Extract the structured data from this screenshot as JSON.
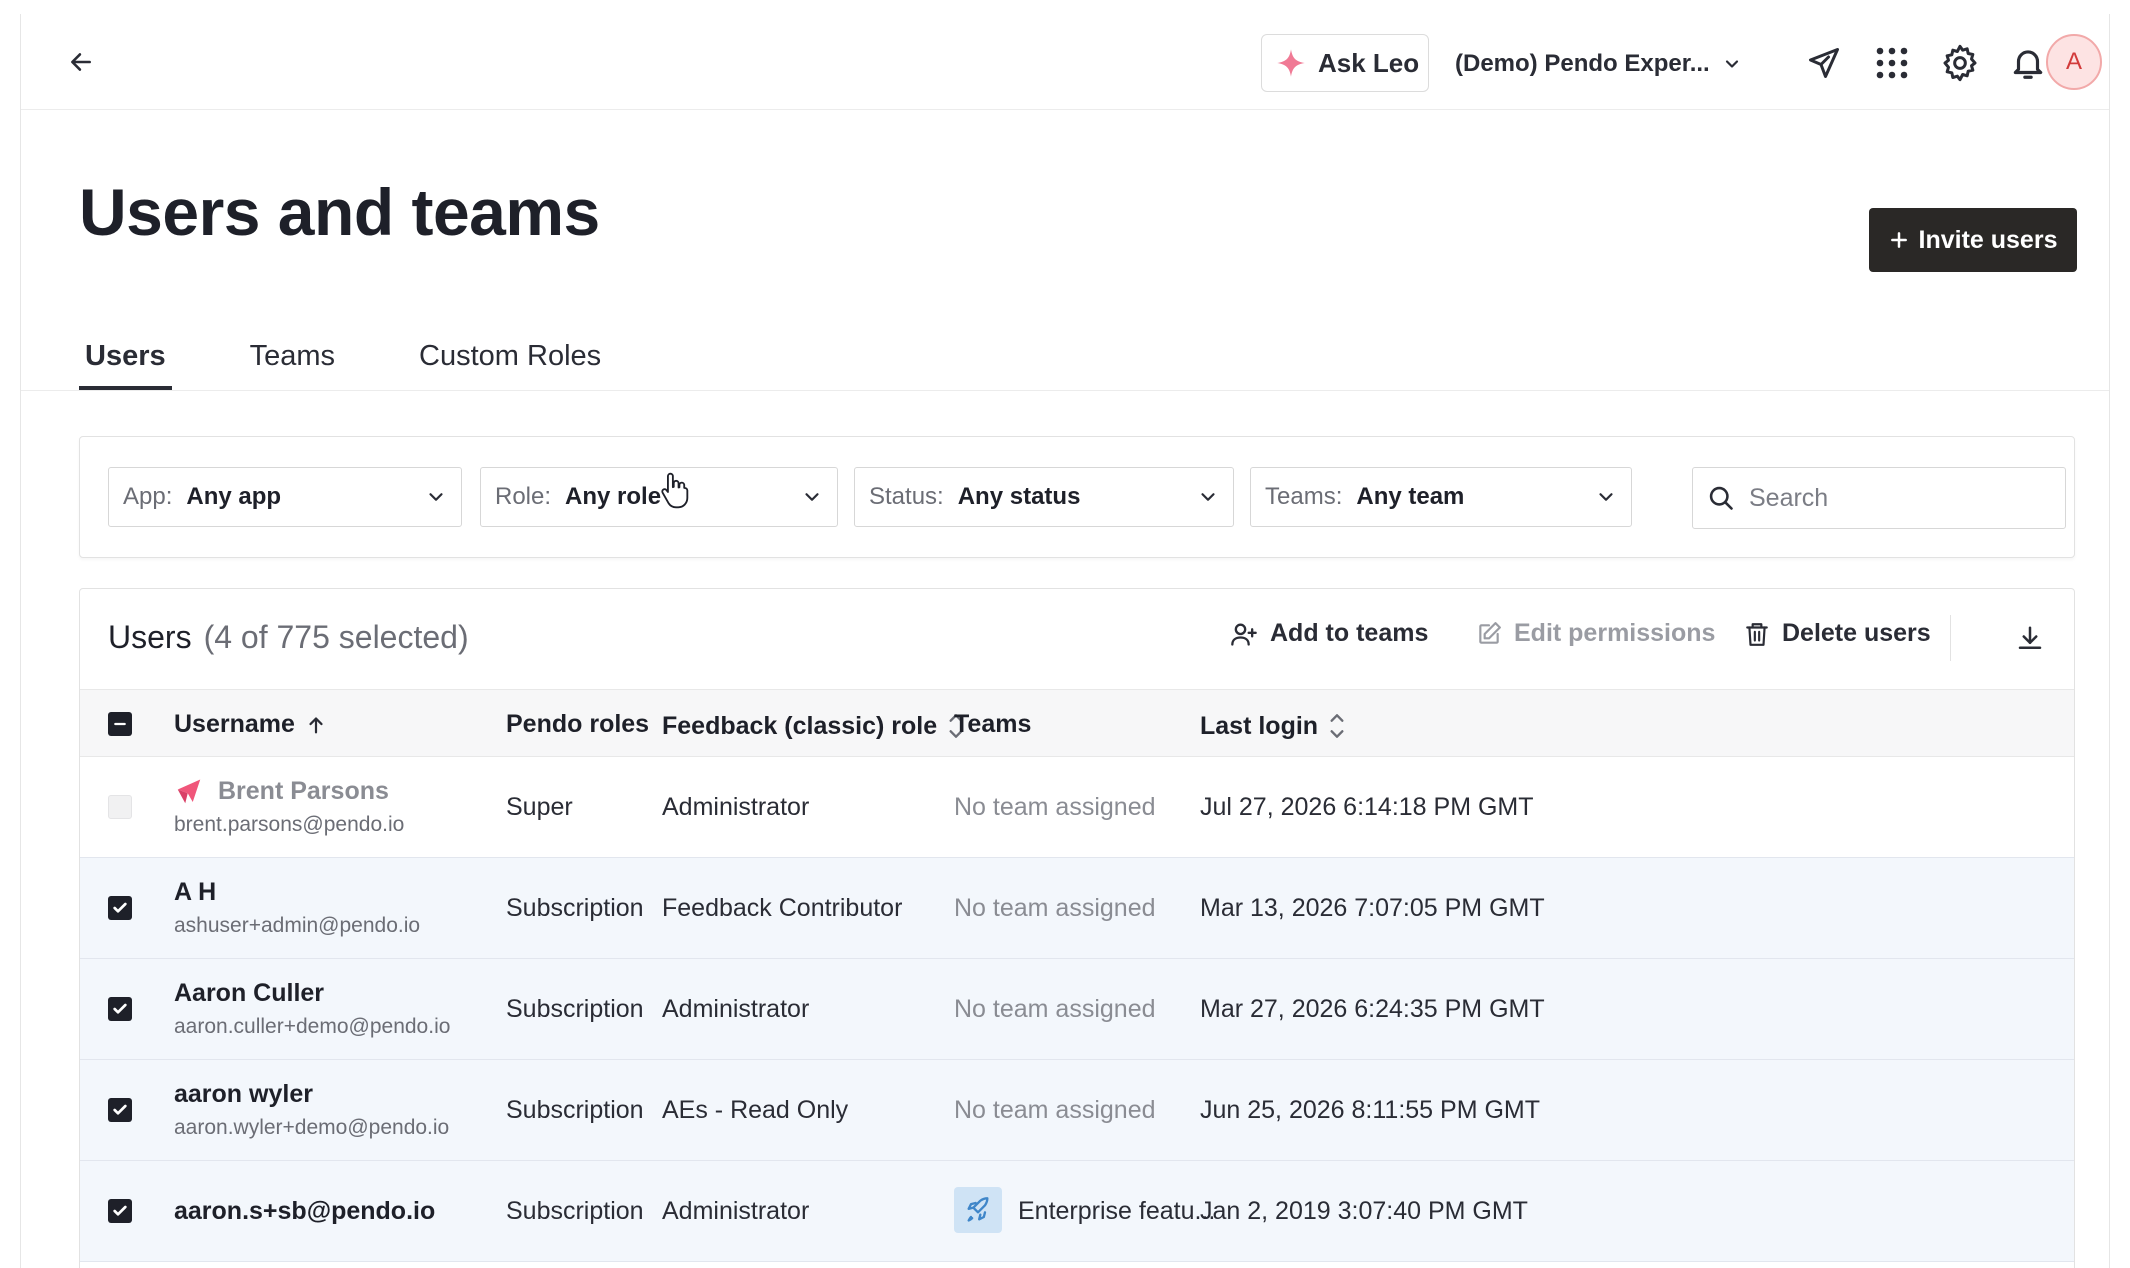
{
  "topbar": {
    "ask_leo": "Ask Leo",
    "app_name": "(Demo) Pendo Exper...",
    "avatar_initial": "A"
  },
  "page": {
    "title": "Users and teams",
    "invite_label": "Invite users"
  },
  "tabs": [
    {
      "label": "Users",
      "active": true
    },
    {
      "label": "Teams",
      "active": false
    },
    {
      "label": "Custom Roles",
      "active": false
    }
  ],
  "filters": {
    "app": {
      "label": "App:",
      "value": "Any app"
    },
    "role": {
      "label": "Role:",
      "value": "Any role"
    },
    "status": {
      "label": "Status:",
      "value": "Any status"
    },
    "teams": {
      "label": "Teams:",
      "value": "Any team"
    },
    "search_placeholder": "Search"
  },
  "table": {
    "title": "Users",
    "count": "(4 of 775 selected)",
    "actions": {
      "add_to_teams": "Add to teams",
      "edit_permissions": "Edit permissions",
      "delete_users": "Delete users"
    },
    "columns": {
      "username": "Username",
      "pendo_roles": "Pendo roles",
      "feedback_role": "Feedback (classic) role",
      "teams": "Teams",
      "last_login": "Last login"
    },
    "rows": [
      {
        "name": "Brent Parsons",
        "email": "brent.parsons@pendo.io",
        "pendo_role": "Super",
        "feedback_role": "Administrator",
        "team": "No team assigned",
        "last_login": "Jul 27, 2026 6:14:18 PM GMT",
        "checked": false
      },
      {
        "name": "A H",
        "email": "ashuser+admin@pendo.io",
        "pendo_role": "Subscription ac",
        "feedback_role": "Feedback Contributor",
        "team": "No team assigned",
        "last_login": "Mar 13, 2026 7:07:05 PM GMT",
        "checked": true
      },
      {
        "name": "Aaron Culler",
        "email": "aaron.culler+demo@pendo.io",
        "pendo_role": "Subscription ac",
        "feedback_role": "Administrator",
        "team": "No team assigned",
        "last_login": "Mar 27, 2026 6:24:35 PM GMT",
        "checked": true
      },
      {
        "name": "aaron wyler",
        "email": "aaron.wyler+demo@pendo.io",
        "pendo_role": "Subscription ac",
        "feedback_role": "AEs - Read Only",
        "team": "No team assigned",
        "last_login": "Jun 25, 2026 8:11:55 PM GMT",
        "checked": true
      },
      {
        "name": "aaron.s+sb@pendo.io",
        "email": "",
        "pendo_role": "Subscription ac",
        "feedback_role": "Administrator",
        "team": "Enterprise featu...",
        "last_login": "Jan 2, 2019 3:07:40 PM GMT",
        "checked": true
      }
    ]
  },
  "colors": {
    "accent_dark": "#2a2826",
    "pendo_pink": "#f0567a",
    "selected_row": "#f3f7fc"
  }
}
